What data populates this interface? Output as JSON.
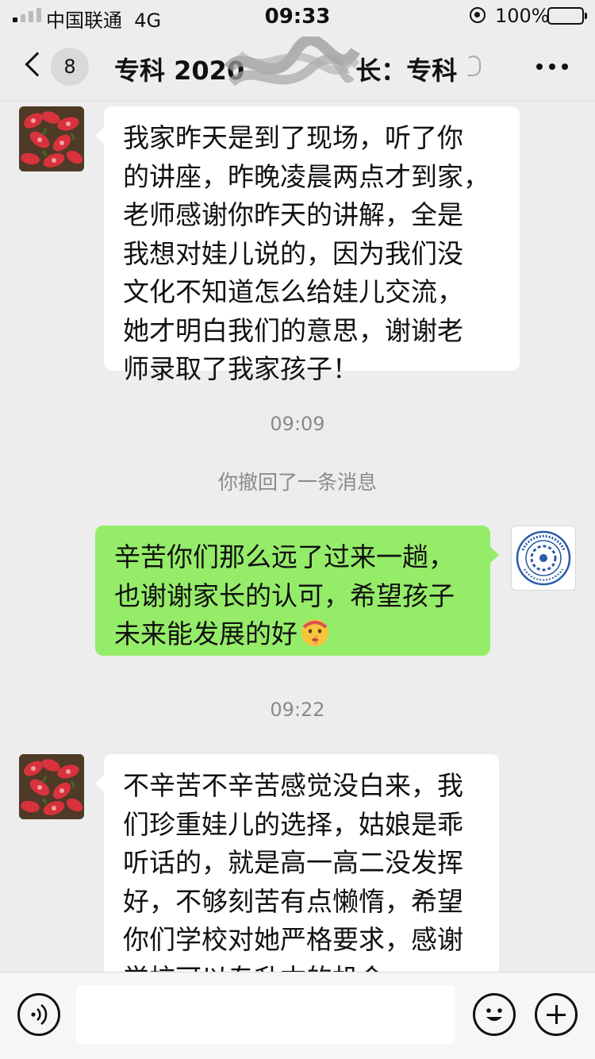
{
  "status_bar": {
    "carrier": "中国联通",
    "network": "4G",
    "time": "09:33",
    "battery": "100%",
    "signal_bars_active": 1,
    "signal_bars_total": 4
  },
  "nav": {
    "unread_count": "8",
    "title": "专科 2020",
    "title_suffix": "长：专科",
    "icons": [
      "back-icon",
      "earpiece-icon",
      "more-icon"
    ]
  },
  "messages": [
    {
      "direction": "in",
      "lines": [
        "我家昨天是到了现场，听了你",
        "的讲座，昨晚凌晨两点才到家，",
        "老师感谢你昨天的讲解，全是",
        "我想对娃儿说的，因为我们没",
        "文化不知道怎么给娃儿交流，",
        "她才明白我们的意思，谢谢老",
        "师录取了我家孩子！"
      ]
    },
    {
      "timestamp": "09:09"
    },
    {
      "system": "你撤回了一条消息"
    },
    {
      "direction": "out",
      "lines": [
        "辛苦你们那么远了过来一趟，",
        "也谢谢家长的认可，希望孩子",
        "未来能发展的好"
      ],
      "emoji": "shushing-face-emoji"
    },
    {
      "timestamp": "09:22"
    },
    {
      "direction": "in",
      "lines": [
        "不辛苦不辛苦感觉没白来，我",
        "们珍重娃儿的选择，姑娘是乖",
        "听话的，就是高一高二没发挥",
        "好，不够刻苦有点懒惰，希望",
        "你们学校对她严格要求，感谢",
        "学校可以专升本的机会"
      ]
    }
  ],
  "input_bar": {
    "input_value": "",
    "icons": [
      "voice-icon",
      "emoji-face-icon",
      "plus-icon"
    ]
  },
  "colors": {
    "background": "#ededed",
    "bubble_in": "#ffffff",
    "bubble_out": "#95ec69",
    "secondary_text": "#8a8a8a"
  }
}
